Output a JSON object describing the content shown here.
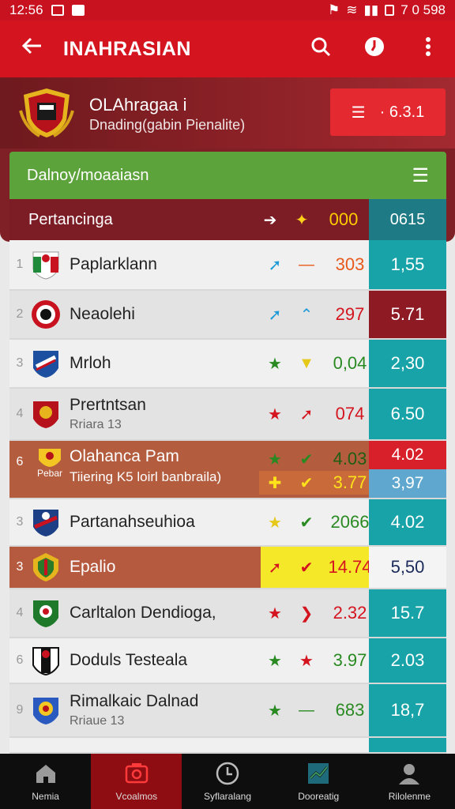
{
  "status": {
    "time": "12:56",
    "battery": "7 0 598"
  },
  "appbar": {
    "title": "INAHRASIAN"
  },
  "header": {
    "name": "OLAhragaa i",
    "subtitle": "Dnading(gabin Pienalite)",
    "button_value": "· 6.3.1"
  },
  "section": {
    "title": "Dalnoy/moaaiasn"
  },
  "columns": {
    "label": "Pertancinga",
    "value_head": "000",
    "odds_head": "0615"
  },
  "rows": [
    {
      "rank": "1",
      "team": "Paplarklann",
      "sub": "",
      "value": "303",
      "odd": "1,55",
      "odd_color": "#18a3a8",
      "val_color": "#e85a1b"
    },
    {
      "rank": "2",
      "team": "Neaolehi",
      "sub": "",
      "value": "297",
      "odd": "5.71",
      "odd_color": "#8e1a24",
      "val_color": "#d4141f"
    },
    {
      "rank": "3",
      "team": "Mrloh",
      "sub": "",
      "value": "0,04",
      "odd": "2,30",
      "odd_color": "#18a3a8",
      "val_color": "#2a8a22"
    },
    {
      "rank": "4",
      "team": "Prertntsan",
      "sub": "Rriara 13",
      "value": "074",
      "odd": "6.50",
      "odd_color": "#18a3a8",
      "val_color": "#d4141f"
    },
    {
      "rank": "6",
      "team": "Olahanca Pam",
      "sub": "Tiiering K5 loirl banbraila)",
      "value": "4.03",
      "value2": "3.77",
      "odd": "4.02",
      "odd2": "3,97",
      "odd_color": "#d8202a",
      "odd2_color": "#5fa7cf",
      "val_color": "#1f7a1f",
      "badge": "Pebar"
    },
    {
      "rank": "3",
      "team": "Partanahseuhioa",
      "sub": "",
      "value": "2066",
      "odd": "4.02",
      "odd_color": "#18a3a8",
      "val_color": "#2a8a22"
    },
    {
      "rank": "3",
      "team": "Epalio",
      "sub": "",
      "value": "14.74",
      "odd": "5,50",
      "odd_color": "#f4f4f4",
      "val_color": "#d4141f"
    },
    {
      "rank": "4",
      "team": "Carltalon Dendioga,",
      "sub": "",
      "value": "2.32",
      "odd": "15.7",
      "odd_color": "#18a3a8",
      "val_color": "#d4141f"
    },
    {
      "rank": "6",
      "team": "Doduls Testeala",
      "sub": "",
      "value": "3.97",
      "odd": "2.03",
      "odd_color": "#18a3a8",
      "val_color": "#2a8a22"
    },
    {
      "rank": "9",
      "team": "Rimalkaic Dalnad",
      "sub": "Rriaue 13",
      "value": "683",
      "odd": "18,7",
      "odd_color": "#18a3a8",
      "val_color": "#2a8a22"
    }
  ],
  "nav": [
    {
      "label": "Nemia",
      "icon": "home-icon"
    },
    {
      "label": "Vcoalmos",
      "icon": "camera-icon"
    },
    {
      "label": "Syflaralang",
      "icon": "clock-icon"
    },
    {
      "label": "Dooreatig",
      "icon": "chart-icon"
    },
    {
      "label": "Rilolenme",
      "icon": "profile-icon"
    }
  ]
}
